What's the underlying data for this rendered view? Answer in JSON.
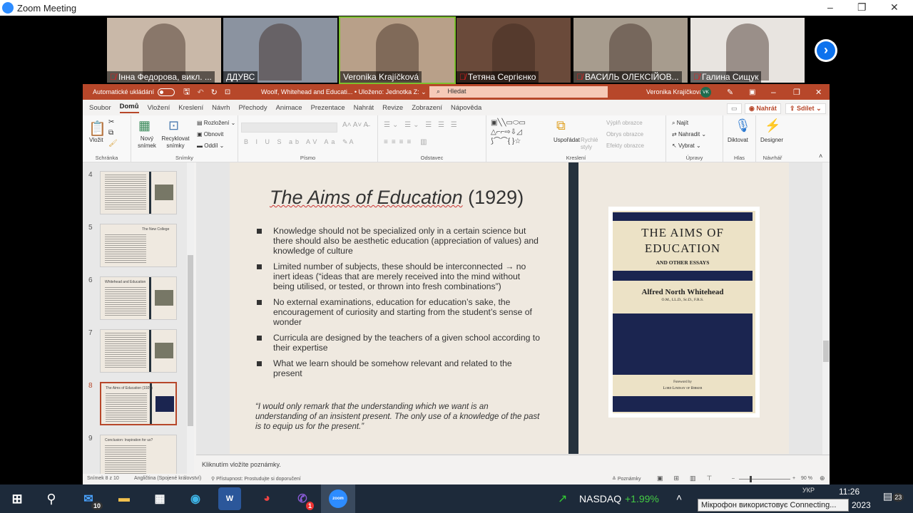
{
  "zoom": {
    "title": "Zoom Meeting",
    "controls": [
      "–",
      "❐",
      "✕"
    ]
  },
  "participants": [
    {
      "name": "Інна Федорова, викл. ...",
      "muted": true,
      "color": "#c9b8a8"
    },
    {
      "name": "ДДУВС",
      "muted": false,
      "color": "#8b93a0"
    },
    {
      "name": "Veronika Krajíčková",
      "muted": false,
      "color": "#b8a089",
      "active": true
    },
    {
      "name": "Тетяна Сергієнко",
      "muted": true,
      "color": "#6a4a3a"
    },
    {
      "name": "ВАСИЛЬ ОЛЕКСІЙОВ...",
      "muted": true,
      "color": "#a79c8e"
    },
    {
      "name": "Галина Сищук",
      "muted": true,
      "color": "#e8e4e0"
    }
  ],
  "ppt": {
    "autosave": "Automatické ukládání",
    "doc_title": "Woolf, Whitehead and Educati... • Uloženo: Jednotka Z: ⌄",
    "search": "Hledat",
    "user": "Veronika Krajíčková",
    "user_initials": "VK",
    "tabs": [
      "Soubor",
      "Domů",
      "Vložení",
      "Kreslení",
      "Návrh",
      "Přechody",
      "Animace",
      "Prezentace",
      "Nahrát",
      "Revize",
      "Zobrazení",
      "Nápověda"
    ],
    "record_btn": "Nahrát",
    "share_btn": "Sdílet",
    "ribbon": {
      "clipboard": {
        "paste": "Vložit",
        "label": "Schránka"
      },
      "slides": {
        "new": "Nový snímek",
        "recycle": "Recyklovat snímky",
        "layout": "Rozložení",
        "reset": "Obnovit",
        "section": "Oddíl",
        "label": "Snímky"
      },
      "font": {
        "label": "Písmo"
      },
      "paragraph": {
        "label": "Odstavec"
      },
      "drawing": {
        "arrange": "Uspořádat",
        "quick": "Rychlé styly",
        "fill": "Výplň obrazce",
        "outline": "Obrys obrazce",
        "effects": "Efekty obrazce",
        "label": "Kreslení"
      },
      "editing": {
        "find": "Najít",
        "replace": "Nahradit",
        "select": "Vybrat",
        "label": "Úpravy"
      },
      "voice": {
        "dictate": "Diktovat",
        "label": "Hlas"
      },
      "designer": {
        "btn": "Designer",
        "label": "Návrhář"
      }
    },
    "thumbnails": [
      {
        "num": "4",
        "title": ""
      },
      {
        "num": "5",
        "title": "The New College"
      },
      {
        "num": "6",
        "title": "Whitehead and Education"
      },
      {
        "num": "7",
        "title": ""
      },
      {
        "num": "8",
        "title": "The Aims of Education (1929)",
        "selected": true
      },
      {
        "num": "9",
        "title": "Conclusion: Inspiration for us?"
      }
    ],
    "slide": {
      "title_italic": "The Aims of Education",
      "title_year": " (1929)",
      "bullets": [
        "Knowledge should not be specialized only in a certain science but there should also be aesthetic education (appreciation of values) and knowledge of culture",
        "Limited number of subjects, these should be interconnected → no inert ideas (“ideas that are merely received into the mind without being utilised, or tested, or thrown into fresh combinations”)",
        "No external examinations, education for education’s sake, the encouragement of curiosity and starting from the student’s sense of wonder",
        "Curricula are designed by the teachers of a given school according to their expertise",
        "What we learn should be somehow relevant and related to the present"
      ],
      "quote": "“I would only remark that the understanding which we want is an understanding of an insistent present. The only use of a knowledge of the past is to equip us for the present.”",
      "book": {
        "title1": "THE AIMS OF",
        "title2": "EDUCATION",
        "subtitle": "AND OTHER ESSAYS",
        "author": "Alfred North Whitehead",
        "degrees": "O.M., LL.D., Sc.D., F.R.S.",
        "foreword": "Foreword by",
        "foreword_by": "Lord Lindsay of Birker"
      }
    },
    "notes_placeholder": "Kliknutím vložíte poznámky.",
    "status": {
      "slide": "Snímek 8 z 10",
      "language": "Angličtina (Spojené království)",
      "accessibility": "Přístupnost: Prostudujte si doporučení",
      "notes": "Poznámky",
      "zoom": "90 %",
      "zoom_value": 90
    }
  },
  "taskbar": {
    "mail_badge": "10",
    "viber_badge": "1",
    "ticker": "NASDAQ",
    "ticker_change": "+1.99%",
    "time": "11:26",
    "date": "2023",
    "lang": "УКР",
    "notif": "23",
    "tooltip": "Мікрофон використовує Connecting..."
  }
}
